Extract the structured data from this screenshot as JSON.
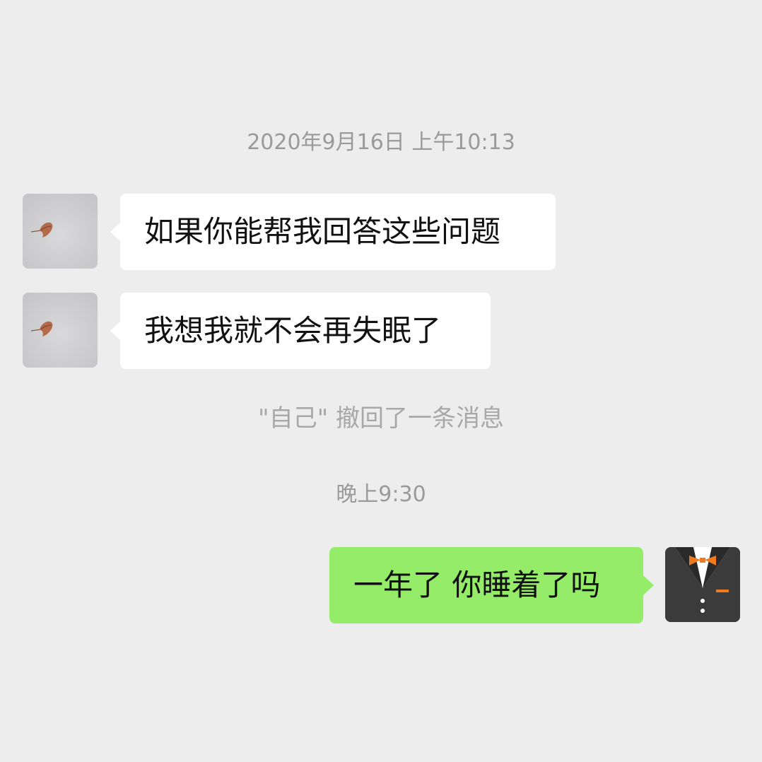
{
  "timestamps": {
    "first": "2020年9月16日 上午10:13",
    "second": "晚上9:30"
  },
  "messages": [
    {
      "side": "incoming",
      "text": "如果你能帮我回答这些问题",
      "avatar": "leaf-avatar"
    },
    {
      "side": "incoming",
      "text": "我想我就不会再失眠了",
      "avatar": "leaf-avatar"
    },
    {
      "side": "outgoing",
      "text": "一年了 你睡着了吗",
      "avatar": "tuxedo-avatar"
    }
  ],
  "system_notice": "\"自己\" 撤回了一条消息",
  "colors": {
    "background": "#ededed",
    "incoming_bubble": "#ffffff",
    "outgoing_bubble": "#95ec69",
    "meta_text": "#9a9a9a"
  }
}
